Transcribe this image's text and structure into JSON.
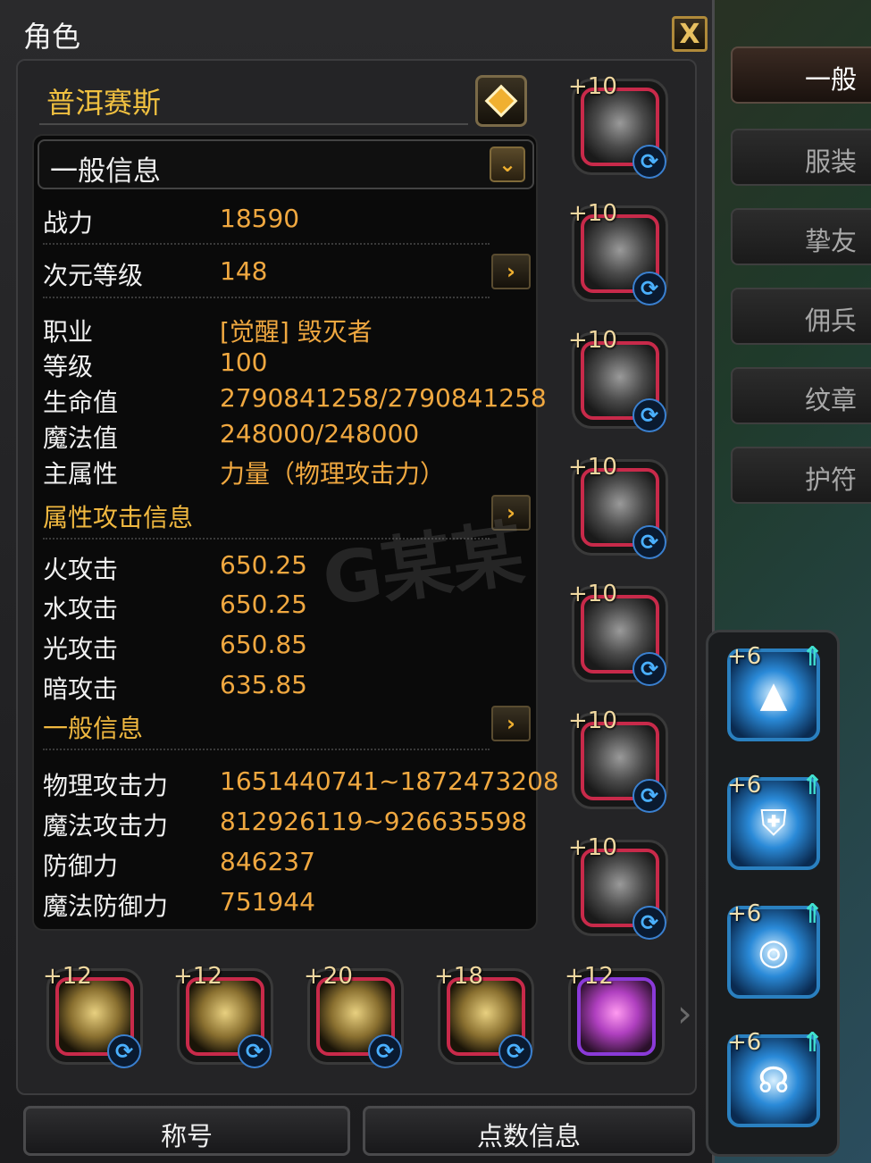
{
  "window": {
    "title": "角色",
    "close_label": "X"
  },
  "character": {
    "name": "普洱赛斯"
  },
  "dropdown": {
    "label": "一般信息"
  },
  "stats": {
    "combat_power": {
      "label": "战力",
      "value": "18590"
    },
    "dimension_level": {
      "label": "次元等级",
      "value": "148"
    },
    "job": {
      "label": "职业",
      "value": "[觉醒] 毁灭者"
    },
    "level": {
      "label": "等级",
      "value": "100"
    },
    "hp": {
      "label": "生命值",
      "value": "2790841258/2790841258"
    },
    "mp": {
      "label": "魔法值",
      "value": "248000/248000"
    },
    "main_attr": {
      "label": "主属性",
      "value": "力量（物理攻击力）"
    }
  },
  "elemental": {
    "header": "属性攻击信息",
    "fire": {
      "label": "火攻击",
      "value": "650.25"
    },
    "water": {
      "label": "水攻击",
      "value": "650.25"
    },
    "light": {
      "label": "光攻击",
      "value": "650.85"
    },
    "dark": {
      "label": "暗攻击",
      "value": "635.85"
    }
  },
  "general": {
    "header": "一般信息",
    "phys_atk": {
      "label": "物理攻击力",
      "value": "1651440741~1872473208"
    },
    "mag_atk": {
      "label": "魔法攻击力",
      "value": "812926119~926635598"
    },
    "defense": {
      "label": "防御力",
      "value": "846237"
    },
    "mag_def": {
      "label": "魔法防御力",
      "value": "751944"
    }
  },
  "equip_right": [
    {
      "plus": "+10",
      "icon": "helmet-icon"
    },
    {
      "plus": "+10",
      "icon": "shoulder-armor-icon"
    },
    {
      "plus": "+10",
      "icon": "chest-armor-icon"
    },
    {
      "plus": "+10",
      "icon": "leg-armor-icon"
    },
    {
      "plus": "+10",
      "icon": "gauntlet-icon"
    },
    {
      "plus": "+10",
      "icon": "weapon-icon"
    },
    {
      "plus": "+10",
      "icon": "boots-icon"
    }
  ],
  "equip_bottom": [
    {
      "plus": "+12",
      "icon": "necklace-icon"
    },
    {
      "plus": "+12",
      "icon": "earring-icon"
    },
    {
      "plus": "+20",
      "icon": "ring-icon"
    },
    {
      "plus": "+18",
      "icon": "ring-icon"
    },
    {
      "plus": "+12",
      "icon": "crystal-icon"
    }
  ],
  "runes": [
    {
      "plus": "+6",
      "icon": "triangle-rune-icon"
    },
    {
      "plus": "+6",
      "icon": "shield-rune-icon"
    },
    {
      "plus": "+6",
      "icon": "compass-rune-icon"
    },
    {
      "plus": "+6",
      "icon": "wing-rune-icon"
    }
  ],
  "tabs": [
    "一般",
    "服装",
    "挚友",
    "佣兵",
    "纹章",
    "护符"
  ],
  "bottom_buttons": {
    "title": "称号",
    "points": "点数信息"
  },
  "watermark": "G某某",
  "colors": {
    "accent": "#f0a840",
    "name": "#f0c040",
    "slot_border": "#c82a4a",
    "rune": "#2a80c0"
  }
}
